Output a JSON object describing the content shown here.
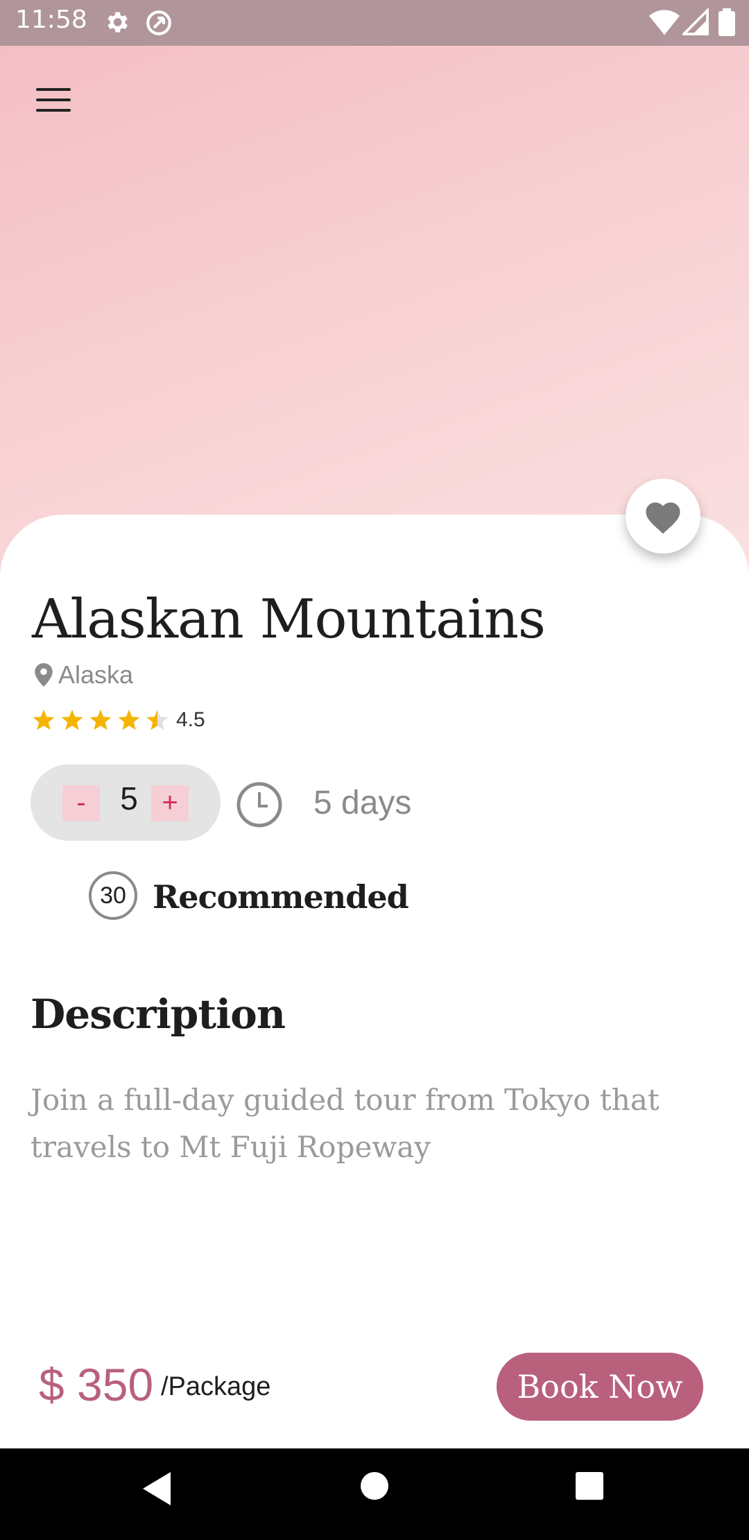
{
  "status_bar": {
    "time": "11:58"
  },
  "tour": {
    "title": "Alaskan Mountains",
    "location": "Alaska",
    "rating": 4.5,
    "rating_label": "4.5",
    "quantity": "5",
    "minus_label": "-",
    "plus_label": "+",
    "duration": "5 days",
    "recommended_count": "30",
    "recommended_label": "Recommended"
  },
  "description": {
    "heading": "Description",
    "text": "Join a full-day guided tour from Tokyo that travels to Mt Fuji Ropeway"
  },
  "footer": {
    "price": "$ 350",
    "price_unit": "/Package",
    "book_label": "Book Now"
  },
  "colors": {
    "accent": "#b9607c",
    "star": "#f5b400",
    "hero_gradient": "#f5c6ca",
    "stepper_bg": "#e4e4e4"
  },
  "icons": [
    "settings-icon",
    "sync-icon",
    "wifi-icon",
    "signal-icon",
    "battery-icon",
    "menu-icon",
    "heart-icon",
    "map-pin-icon",
    "star-icon",
    "clock-icon",
    "back-icon",
    "home-icon",
    "recents-icon"
  ]
}
